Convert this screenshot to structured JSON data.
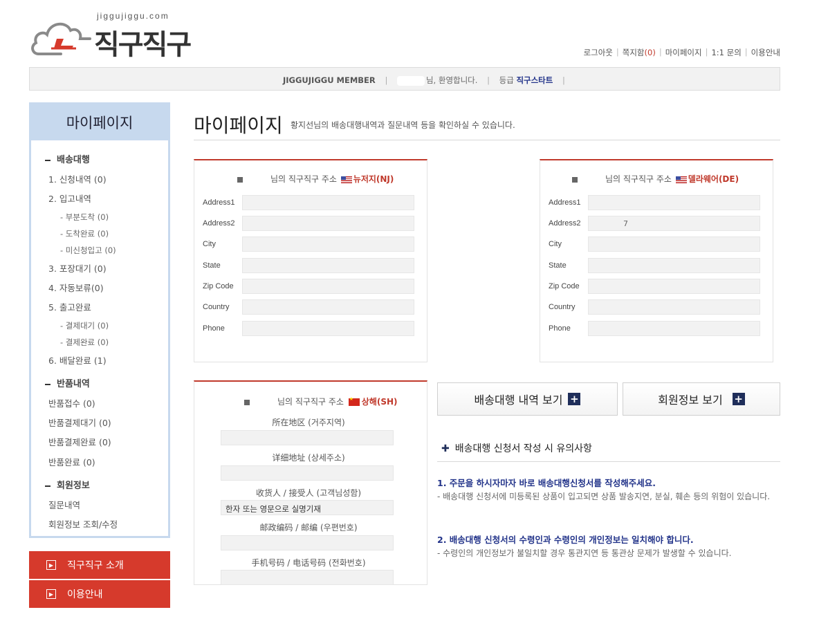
{
  "logo": {
    "domain": "jiggujiggu.com",
    "brand": "직구직구"
  },
  "topnav": {
    "logout": "로그아웃",
    "message": "쪽지함",
    "message_count": "(0)",
    "mypage": "마이페이지",
    "inquiry": "1:1 문의",
    "guide": "이용안내"
  },
  "member": {
    "label": "JIGGUJIGGU MEMBER",
    "welcome": "님, 환영합니다.",
    "grade_label": "등급",
    "grade": "직구스타트"
  },
  "sidebar": {
    "title": "마이페이지",
    "sec_shipping": "배송대행",
    "items": {
      "apply": "1. 신청내역 (0)",
      "warehouse": "2. 입고내역",
      "partial": "- 부분도착 (0)",
      "arrived": "- 도착완료 (0)",
      "unreg": "- 미신청입고 (0)",
      "packing": "3. 포장대기 (0)",
      "hold": "4. 자동보류(0)",
      "shipout": "5. 출고완료",
      "paywait": "- 결제대기 (0)",
      "paydone": "- 결제완료 (0)",
      "delivered": "6. 배달완료 (1)"
    },
    "sec_return": "반품내역",
    "returns": {
      "recv": "반품접수 (0)",
      "paywait": "반품결제대기 (0)",
      "paydone": "반품결제완료 (0)",
      "done": "반품완료 (0)"
    },
    "sec_member": "회원정보",
    "member": {
      "qna": "질문내역",
      "info": "회원정보 조회/수정"
    }
  },
  "side_buttons": {
    "intro": "직구직구 소개",
    "guide": "이용안내"
  },
  "main": {
    "title": "마이페이지",
    "desc": "황지선님의 배송대행내역과 질문내역 등을 확인하실 수 있습니다."
  },
  "card_nj": {
    "title": "님의 직구직구 주소",
    "state": "뉴저지(NJ)",
    "labels": [
      "Address1",
      "Address2",
      "City",
      "State",
      "Zip Code",
      "Country",
      "Phone"
    ],
    "values": [
      "",
      "",
      "",
      "",
      "",
      "",
      ""
    ]
  },
  "card_de": {
    "title": "님의 직구직구 주소",
    "state": "델라웨어(DE)",
    "labels": [
      "Address1",
      "Address2",
      "City",
      "State",
      "Zip Code",
      "Country",
      "Phone"
    ],
    "values": [
      "",
      "7",
      "",
      "",
      "",
      "",
      ""
    ]
  },
  "card_sh": {
    "title": "님의 직구직구 주소",
    "state": "상해(SH)",
    "labels": [
      "所在地区 (거주지역)",
      "详细地址 (상세주소)",
      "收货人 / 接受人 (고객님성함)",
      "邮政编码 / 邮编 (우편번호)",
      "手机号码 / 电话号码 (전화번호)"
    ],
    "values": [
      "",
      "",
      "한자 또는 영문으로 실명기재",
      "",
      ""
    ]
  },
  "buttons": {
    "history": "배송대행 내역 보기",
    "member_info": "회원정보 보기"
  },
  "notice": {
    "title": "배송대행 신청서 작성 시 유의사항",
    "h1": "1. 주문을 하시자마자 바로 배송대행신청서를 작성해주세요.",
    "b1": "- 배송대행 신청서에 미등록된 상품이 입고되면 상품 발송지연, 분실, 훼손 등의 위험이 있습니다.",
    "h2": "2. 배송대행 신청서의 수령인과 수령인의 개인정보는 일치해야 합니다.",
    "b2": "- 수령인의 개인정보가 불일치할 경우 통관지연 등 통관상 문제가 발생할 수 있습니다."
  }
}
